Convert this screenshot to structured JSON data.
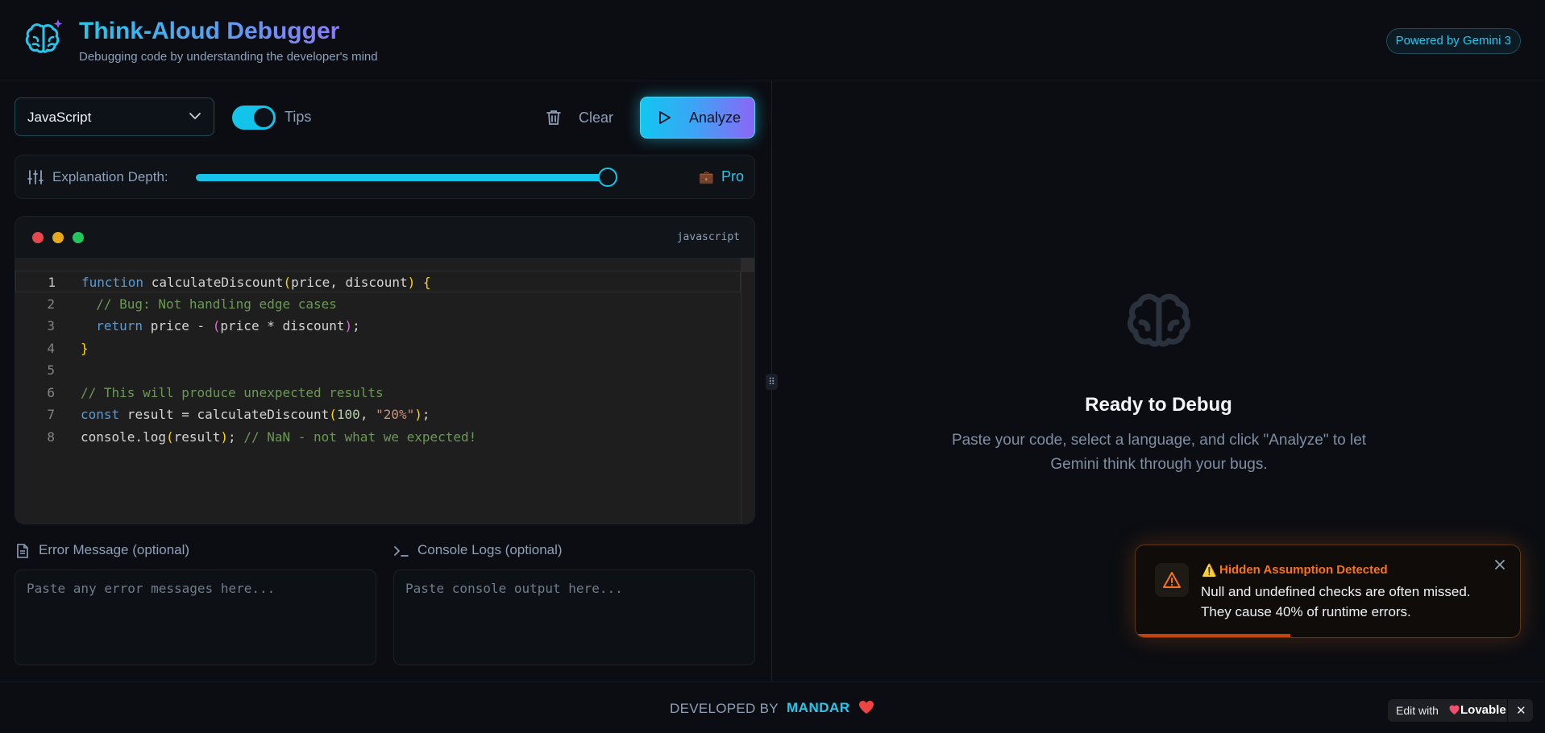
{
  "header": {
    "title": "Think-Aloud Debugger",
    "subtitle": "Debugging code by understanding the developer's mind",
    "badge": "Powered by Gemini 3",
    "logo_icon": "brain-sparkle-icon"
  },
  "toolbar": {
    "language": "JavaScript",
    "tips_label": "Tips",
    "tips_enabled": true,
    "clear_label": "Clear",
    "analyze_label": "Analyze"
  },
  "depth": {
    "label": "Explanation Depth:",
    "level_label": "Pro",
    "value_fraction": 1.0
  },
  "editor": {
    "language_tag": "javascript",
    "window_dots": [
      "#e5484d",
      "#e5a91a",
      "#22c55e"
    ],
    "line_numbers": [
      "1",
      "2",
      "3",
      "4",
      "5",
      "6",
      "7",
      "8"
    ],
    "active_line": 1,
    "lines": [
      [
        {
          "t": "kw",
          "v": "function"
        },
        {
          "t": "var",
          "v": " calculateDiscount"
        },
        {
          "t": "b1",
          "v": "("
        },
        {
          "t": "var",
          "v": "price, discount"
        },
        {
          "t": "b1",
          "v": ")"
        },
        {
          "t": "var",
          "v": " "
        },
        {
          "t": "b1",
          "v": "{"
        }
      ],
      [
        {
          "t": "var",
          "v": "  "
        },
        {
          "t": "cm",
          "v": "// Bug: Not handling edge cases"
        }
      ],
      [
        {
          "t": "var",
          "v": "  "
        },
        {
          "t": "kw",
          "v": "return"
        },
        {
          "t": "var",
          "v": " price - "
        },
        {
          "t": "b2",
          "v": "("
        },
        {
          "t": "var",
          "v": "price * discount"
        },
        {
          "t": "b2",
          "v": ")"
        },
        {
          "t": "var",
          "v": ";"
        }
      ],
      [
        {
          "t": "b1",
          "v": "}"
        }
      ],
      [],
      [
        {
          "t": "cm",
          "v": "// This will produce unexpected results"
        }
      ],
      [
        {
          "t": "kw",
          "v": "const"
        },
        {
          "t": "var",
          "v": " result = calculateDiscount"
        },
        {
          "t": "b1",
          "v": "("
        },
        {
          "t": "num",
          "v": "100"
        },
        {
          "t": "var",
          "v": ", "
        },
        {
          "t": "str",
          "v": "\"20%\""
        },
        {
          "t": "b1",
          "v": ")"
        },
        {
          "t": "var",
          "v": ";"
        }
      ],
      [
        {
          "t": "var",
          "v": "console.log"
        },
        {
          "t": "b1",
          "v": "("
        },
        {
          "t": "var",
          "v": "result"
        },
        {
          "t": "b1",
          "v": ")"
        },
        {
          "t": "var",
          "v": "; "
        },
        {
          "t": "cm",
          "v": "// NaN - not what we expected!"
        }
      ]
    ]
  },
  "inputs": {
    "error_label": "Error Message (optional)",
    "error_placeholder": "Paste any error messages here...",
    "console_label": "Console Logs (optional)",
    "console_placeholder": "Paste console output here..."
  },
  "empty_state": {
    "title": "Ready to Debug",
    "text": "Paste your code, select a language, and click \"Analyze\" to let Gemini think through your bugs."
  },
  "toast": {
    "title": "Hidden Assumption Detected",
    "message": "Null and undefined checks are often missed. They cause 40% of runtime errors.",
    "accent": "#f97316",
    "progress_fraction": 0.4
  },
  "footer": {
    "developed_by": "DEVELOPED BY",
    "name": "MANDAR"
  },
  "lovable": {
    "edit_label": "Edit with",
    "brand": "Lovable"
  },
  "colors": {
    "accent": "#22c8ee",
    "background": "#0b0d12"
  }
}
